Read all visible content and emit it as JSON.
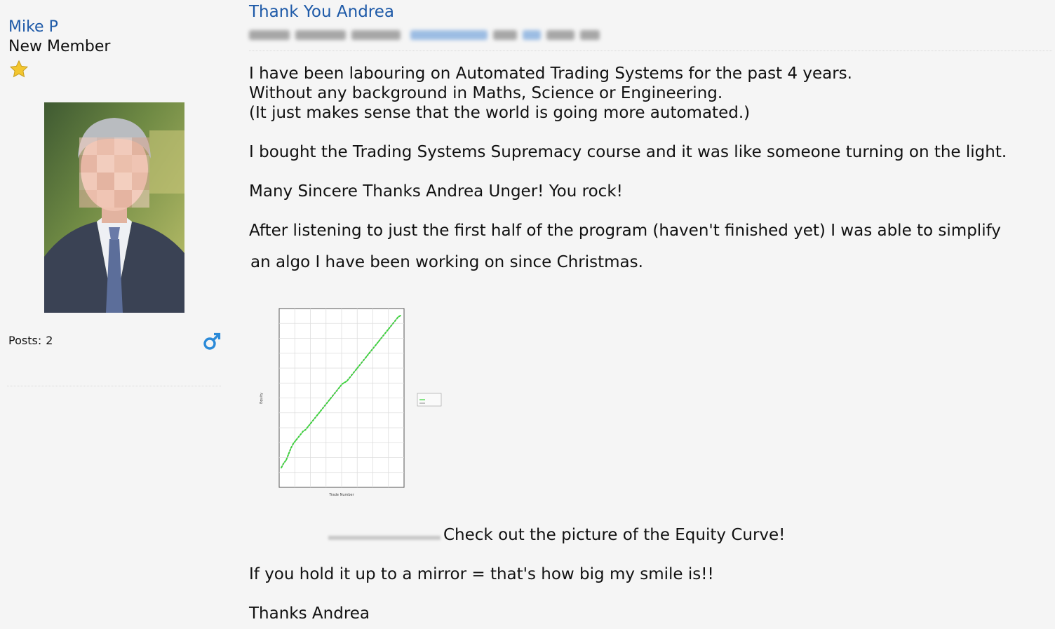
{
  "user": {
    "name": "Mike P",
    "rank": "New Member",
    "rank_icon": "star-icon",
    "posts_label": "Posts:",
    "posts_count": "2",
    "gender_icon": "male-symbol-icon",
    "colors": {
      "link": "#1e5aa8",
      "star": "#f3c62f",
      "gender": "#2b8ad8"
    }
  },
  "post": {
    "title": "Thank You Andrea",
    "paragraphs": [
      {
        "lines": [
          "I have been labouring on Automated Trading Systems for the past 4 years.",
          "Without any background in Maths, Science or Engineering.",
          "(It just makes sense that the world is going more automated.)"
        ]
      },
      {
        "lines": [
          "I bought the Trading Systems Supremacy course and it was like someone turning on the light."
        ]
      },
      {
        "lines": [
          "Many Sincere Thanks Andrea Unger!  You rock!"
        ]
      },
      {
        "lines": [
          "After listening to just the first half of the program (haven't finished yet) I was able to simplify",
          "an algo I have been working on since Christmas."
        ]
      }
    ],
    "image_caption": "Check out the picture of the Equity Curve!",
    "closing": [
      "If you hold it up to a mirror = that's how big my smile is!!",
      "Thanks Andrea"
    ]
  },
  "chart_data": {
    "type": "line",
    "title": "",
    "xlabel": "Trade Number",
    "ylabel": "Equity",
    "grid": true,
    "legend": "right",
    "series": [
      {
        "color": "#3ad43a",
        "values": [
          0,
          3,
          5,
          9,
          13,
          16,
          18,
          20,
          22,
          24,
          25,
          27,
          29,
          31,
          33,
          35,
          37,
          39,
          41,
          43,
          45,
          47,
          49,
          51,
          53,
          55,
          56,
          57,
          59,
          61,
          63,
          65,
          67,
          69,
          71,
          73,
          75,
          77,
          79,
          81,
          83,
          85,
          87,
          89,
          91,
          93,
          95,
          97,
          99,
          100
        ]
      }
    ]
  }
}
